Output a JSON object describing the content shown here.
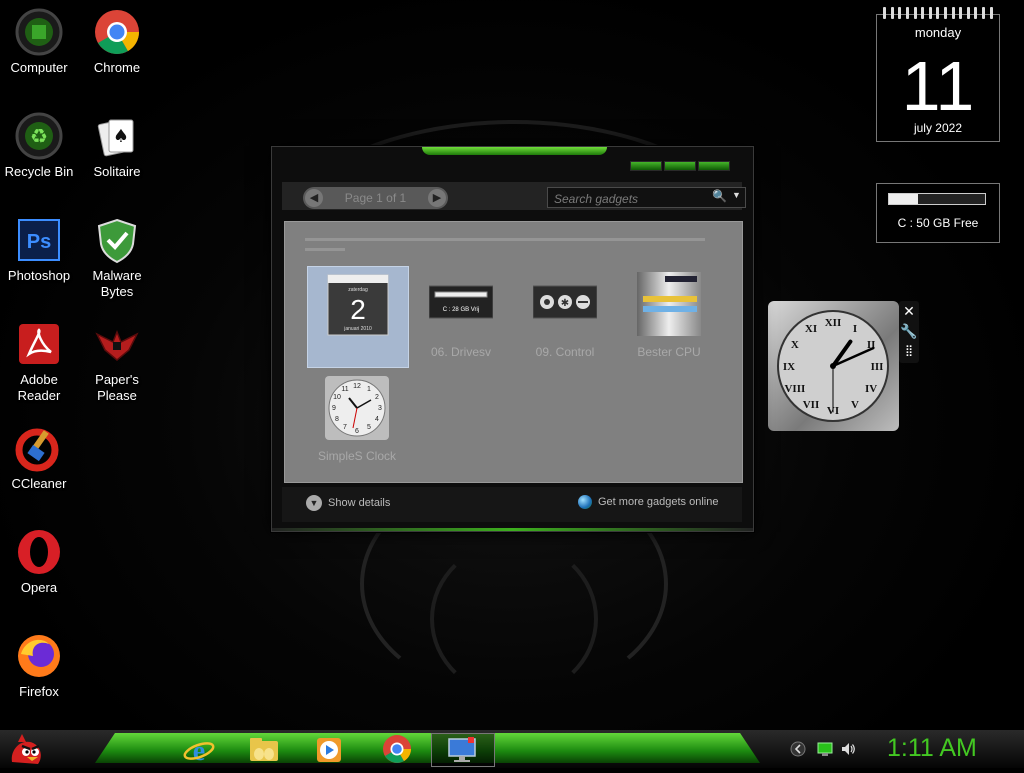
{
  "desktop_icons": [
    {
      "label": "Computer",
      "icon": "computer-icon"
    },
    {
      "label": "Chrome",
      "icon": "chrome-icon"
    },
    {
      "label": "Recycle Bin",
      "icon": "recycle-bin-icon"
    },
    {
      "label": "Solitaire",
      "icon": "solitaire-icon"
    },
    {
      "label": "Photoshop",
      "icon": "photoshop-icon"
    },
    {
      "label": "Malware Bytes",
      "icon": "malwarebytes-icon"
    },
    {
      "label": "Adobe Reader",
      "icon": "adobe-reader-icon"
    },
    {
      "label": "Paper's Please",
      "icon": "papers-please-icon"
    },
    {
      "label": "CCleaner",
      "icon": "ccleaner-icon"
    },
    {
      "label": "Opera",
      "icon": "opera-icon"
    },
    {
      "label": "Firefox",
      "icon": "firefox-icon"
    }
  ],
  "calendar": {
    "day": "monday",
    "date": "11",
    "month": "july 2022"
  },
  "drive": {
    "text": "C : 50 GB Free",
    "used_fraction": 0.3
  },
  "gadget_window": {
    "pager_text": "Page 1 of 1",
    "search_placeholder": "Search gadgets",
    "gadgets": [
      {
        "name": "",
        "icon": "calendar-gadget-icon",
        "selected": true,
        "thumb_day": "zaterdag",
        "thumb_date": "2",
        "thumb_month": "januari 2010"
      },
      {
        "name": "06. Drivesv",
        "icon": "drive-gadget-icon",
        "selected": false,
        "thumb_text": "C : 28 GB Vrij"
      },
      {
        "name": "09. Control",
        "icon": "control-gadget-icon",
        "selected": false
      },
      {
        "name": "Bester CPU",
        "icon": "cpu-gadget-icon",
        "selected": false
      },
      {
        "name": "SimpleS Clock",
        "icon": "clock-gadget-icon",
        "selected": false
      }
    ],
    "show_details": "Show details",
    "get_more": "Get more gadgets online"
  },
  "clock_gadget": {
    "hour": 1,
    "minute": 11,
    "tools": [
      "close-icon",
      "wrench-icon",
      "drag-grip-icon"
    ]
  },
  "taskbar": {
    "start_icon": "angry-bird-start-icon",
    "items": [
      {
        "icon": "internet-explorer-icon",
        "active": false
      },
      {
        "icon": "file-explorer-icon",
        "active": false
      },
      {
        "icon": "media-player-icon",
        "active": false
      },
      {
        "icon": "chrome-icon",
        "active": false
      },
      {
        "icon": "gadgets-desktop-icon",
        "active": true
      }
    ],
    "tray": [
      "chevron-icon",
      "network-icon",
      "volume-icon"
    ],
    "time": "1:11 AM"
  },
  "colors": {
    "accent_green": "#43c822",
    "glow_green": "#63d83a"
  }
}
